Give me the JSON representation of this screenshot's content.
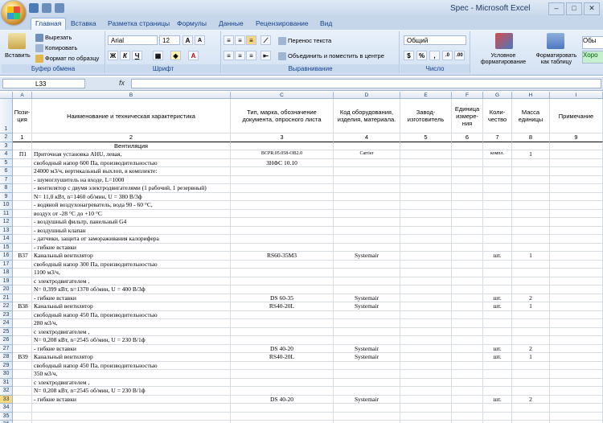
{
  "app": {
    "title": "Spec - Microsoft Excel"
  },
  "tabs": [
    "Главная",
    "Вставка",
    "Разметка страницы",
    "Формулы",
    "Данные",
    "Рецензирование",
    "Вид"
  ],
  "ribbon": {
    "paste": "Вставить",
    "cut": "Вырезать",
    "copy": "Копировать",
    "format_painter": "Формат по образцу",
    "clipboard_group": "Буфер обмена",
    "font_name": "Arial",
    "font_size": "12",
    "font_group": "Шрифт",
    "wrap_text": "Перенос текста",
    "merge_center": "Объединить и поместить в центре",
    "alignment_group": "Выравнивание",
    "number_format": "Общий",
    "number_group": "Число",
    "conditional_format": "Условное форматирование",
    "format_table": "Форматировать как таблицу",
    "style_normal": "Обы",
    "style_good": "Хоро"
  },
  "formula_bar": {
    "name_box": "L33",
    "fx": "fx",
    "value": ""
  },
  "columns": [
    "A",
    "B",
    "C",
    "D",
    "E",
    "F",
    "G",
    "H",
    "I"
  ],
  "header_row": [
    "Пози-ция",
    "Наименование и техническая характеристика",
    "Тип, марка, обозначение документа, опросного листа",
    "Код оборудования, изделия, материала.",
    "Завод-изготовитель",
    "Единица измере-ния",
    "Коли-чество",
    "Масса единицы",
    "Примечание"
  ],
  "number_row": [
    "1",
    "2",
    "3",
    "4",
    "5",
    "6",
    "7",
    "8",
    "9"
  ],
  "section_title": "Вентиляция",
  "rows": [
    {
      "n": "4",
      "a": "П1",
      "b": "Приточная установка AHU, левая,",
      "c": "BCPR.05.058-OB2.0",
      "d": "Carrier",
      "g": "компл.",
      "h": "1"
    },
    {
      "n": "5",
      "b": "свободный напор 600 Па, производительностью",
      "c": "ЗНФС 10.10"
    },
    {
      "n": "6",
      "b": "24000 м3/ч, вертикальный выхлоп, в комплекте:"
    },
    {
      "n": "7",
      "b": "- шумоглушитель на входе, L=1000"
    },
    {
      "n": "8",
      "b": "- вентилятор с двумя электродвигателями (1 рабочий, 1 резервный)"
    },
    {
      "n": "9",
      "b": "N= 11,0 кВт, n=1460 об/мин, U = 380 В/3ф"
    },
    {
      "n": "10",
      "b": "- водяной воздухонагреватель, вода 90 - 60 °С,"
    },
    {
      "n": "11",
      "b": "воздух от -28 °С до +10 °С"
    },
    {
      "n": "12",
      "b": "- воздушный фильтр, панельный G4"
    },
    {
      "n": "13",
      "b": "- воздушный клапан"
    },
    {
      "n": "14",
      "b": "- датчики, защита от замораживания калорифера"
    },
    {
      "n": "15",
      "b": "- гибкие вставки"
    },
    {
      "n": "16",
      "a": "В37",
      "b": "Канальный вентилятор",
      "c": "RS60-35М3",
      "d": "Systemair",
      "g": "шт.",
      "h": "1"
    },
    {
      "n": "17",
      "b": "свободный напор 300 Па, производительностью"
    },
    {
      "n": "18",
      "b": "1100 м3/ч,"
    },
    {
      "n": "19",
      "b": "с электродвигателем ,"
    },
    {
      "n": "20",
      "b": "N= 0,399 кВт, n=1370 об/мин, U = 400 В/3ф"
    },
    {
      "n": "21",
      "b": "- гибкие вставки",
      "c": "DS 60-35",
      "d": "Systemair",
      "g": "шт.",
      "h": "2"
    },
    {
      "n": "22",
      "a": "В38",
      "b": "Канальный вентилятор",
      "c": "RS40-20L",
      "d": "Systemair",
      "g": "шт.",
      "h": "1"
    },
    {
      "n": "23",
      "b": "свободный напор 450 Па, производительностью"
    },
    {
      "n": "24",
      "b": "280 м3/ч,"
    },
    {
      "n": "25",
      "b": "с электродвигателем ,"
    },
    {
      "n": "26",
      "b": "N= 0,208 кВт, n=2545 об/мин, U = 230 В/1ф"
    },
    {
      "n": "27",
      "b": "- гибкие вставки",
      "c": "DS 40-20",
      "d": "Systemair",
      "g": "шт.",
      "h": "2"
    },
    {
      "n": "28",
      "a": "В39",
      "b": "Канальный вентилятор",
      "c": "RS40-20L",
      "d": "Systemair",
      "g": "шт.",
      "h": "1"
    },
    {
      "n": "29",
      "b": "свободный напор 450 Па, производительностью"
    },
    {
      "n": "30",
      "b": "350 м3/ч,"
    },
    {
      "n": "31",
      "b": "с электродвигателем ,"
    },
    {
      "n": "32",
      "b": "N= 0,208 кВт, n=2545 об/мин, U = 230 В/1ф"
    },
    {
      "n": "33",
      "b": "- гибкие вставки",
      "c": "DS 40-20",
      "d": "Systemair",
      "g": "шт.",
      "h": "2"
    },
    {
      "n": "34"
    },
    {
      "n": "35"
    },
    {
      "n": "36"
    }
  ]
}
